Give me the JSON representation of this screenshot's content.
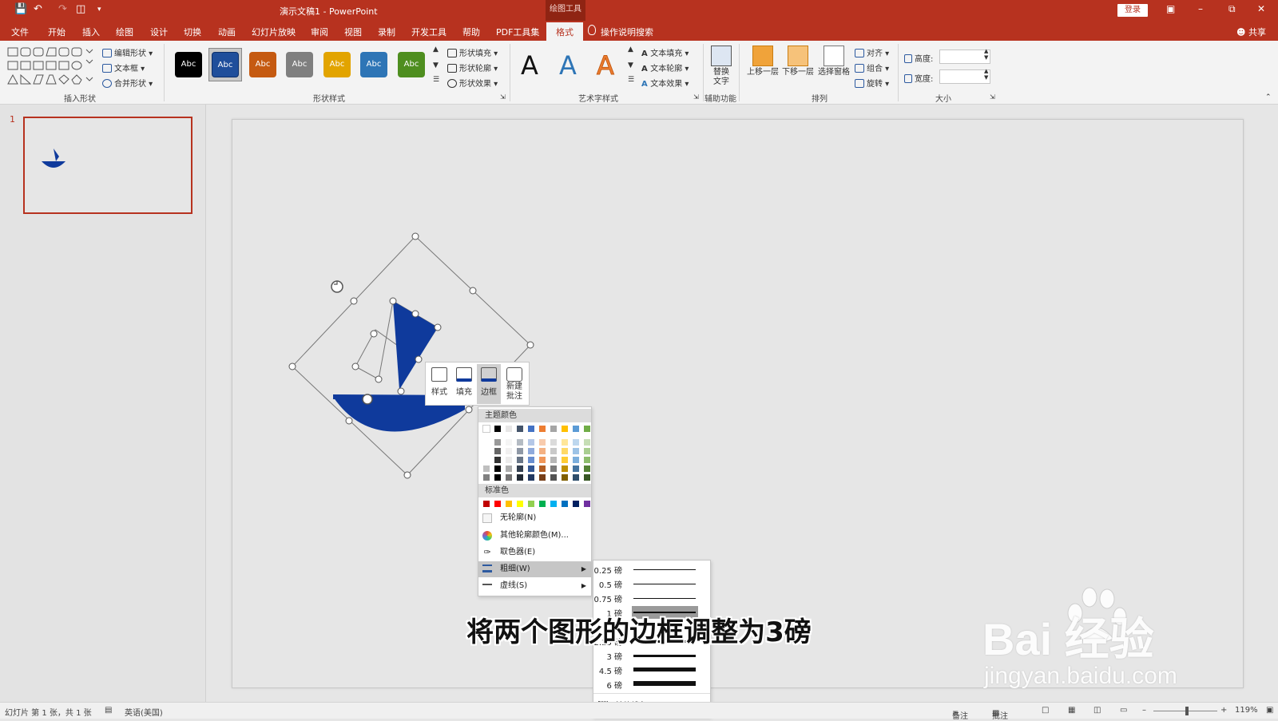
{
  "titlebar": {
    "doc_title": "演示文稿1  -  PowerPoint",
    "context_group": "绘图工具",
    "login": "登录"
  },
  "tabs": [
    "文件",
    "开始",
    "插入",
    "绘图",
    "设计",
    "切换",
    "动画",
    "幻灯片放映",
    "审阅",
    "视图",
    "录制",
    "开发工具",
    "帮助",
    "PDF工具集",
    "格式"
  ],
  "tell_me": "操作说明搜索",
  "share": "共享",
  "ribbon": {
    "insert_shapes": {
      "label": "插入形状",
      "edit_shape": "编辑形状",
      "textbox": "文本框",
      "merge_shapes": "合并形状"
    },
    "shape_styles": {
      "label": "形状样式",
      "sample": "Abc",
      "styles": [
        {
          "color": "#000000"
        },
        {
          "color": "#1f4e9b"
        },
        {
          "color": "#c55a11"
        },
        {
          "color": "#7f7f7f"
        },
        {
          "color": "#e2a400"
        },
        {
          "color": "#2e75b6"
        },
        {
          "color": "#4e8e1f"
        }
      ],
      "fill": "形状填充",
      "outline": "形状轮廓",
      "effects": "形状效果"
    },
    "wordart": {
      "label": "艺术字样式",
      "letters": [
        "A",
        "A",
        "A"
      ],
      "text_fill": "文本填充",
      "text_outline": "文本轮廓",
      "text_effects": "文本效果"
    },
    "accessibility": {
      "label": "辅助功能",
      "alt_text": "替换\n文字"
    },
    "arrange": {
      "label": "排列",
      "bring_forward": "上移一层",
      "send_backward": "下移一层",
      "selection_pane": "选择窗格",
      "align": "对齐",
      "group": "组合",
      "rotate": "旋转"
    },
    "size": {
      "label": "大小",
      "height": "高度:",
      "width": "宽度:"
    }
  },
  "slide_panel": {
    "slide_number": "1"
  },
  "mini_toolbar": {
    "style": "样式",
    "fill": "填充",
    "outline": "边框",
    "new_comment": "新建\n批注"
  },
  "outline_menu": {
    "theme_colors": "主题颜色",
    "standard_colors": "标准色",
    "theme_top": [
      "#ffffff",
      "#000000",
      "#e7e6e6",
      "#44546a",
      "#4472c4",
      "#ed7d31",
      "#a5a5a5",
      "#ffc000",
      "#5b9bd5",
      "#70ad47"
    ],
    "standard": [
      "#c00000",
      "#ff0000",
      "#ffc000",
      "#ffff00",
      "#92d050",
      "#00b050",
      "#00b0f0",
      "#0070c0",
      "#002060",
      "#7030a0"
    ],
    "no_outline": "无轮廓(N)",
    "more_colors": "其他轮廓颜色(M)...",
    "eyedropper": "取色器(E)",
    "weight": "粗细(W)",
    "dashes": "虚线(S)"
  },
  "weight_menu": {
    "items": [
      "0.25 磅",
      "0.5 磅",
      "0.75 磅",
      "1 磅",
      "2.25 磅",
      "3 磅",
      "4.5 磅",
      "6 磅"
    ],
    "selected": "1 磅",
    "more_lines": "其他线条(L)..."
  },
  "caption": "将两个图形的边框调整为3磅",
  "watermark": {
    "main": "Bai  经验",
    "sub": "jingyan.baidu.com"
  },
  "statusbar": {
    "slide_info": "幻灯片 第 1 张，共 1 张",
    "language": "英语(美国)",
    "notes": "备注",
    "comments": "批注",
    "zoom": "119%"
  },
  "colors": {
    "accent": "#b7321f",
    "shape_blue": "#0f3a9c"
  }
}
